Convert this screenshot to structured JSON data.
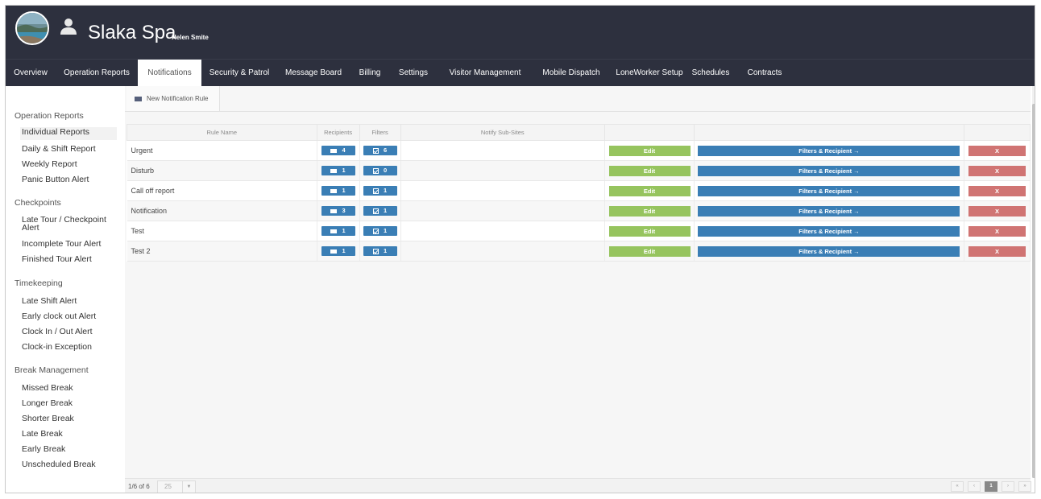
{
  "header": {
    "site_name": "Slaka Spa",
    "user_name": "Helen Smite"
  },
  "nav": {
    "items": [
      {
        "label": "Overview"
      },
      {
        "label": "Operation Reports"
      },
      {
        "label": "Notifications"
      },
      {
        "label": "Security & Patrol"
      },
      {
        "label": "Message Board"
      },
      {
        "label": "Billing"
      },
      {
        "label": "Settings"
      },
      {
        "label": "Visitor Management"
      },
      {
        "label": "Mobile Dispatch"
      },
      {
        "label": "LoneWorker Setup"
      },
      {
        "label": "Schedules"
      },
      {
        "label": "Contracts"
      }
    ],
    "active": "Notifications"
  },
  "sidebar": {
    "groups": [
      {
        "title": "Operation Reports",
        "items": [
          "Individual Reports",
          "Daily & Shift Report",
          "Weekly Report",
          "Panic Button Alert"
        ]
      },
      {
        "title": "Checkpoints",
        "items": [
          "Late Tour / Checkpoint Alert",
          "Incomplete Tour Alert",
          "Finished Tour Alert"
        ]
      },
      {
        "title": "Timekeeping",
        "items": [
          "Late Shift Alert",
          "Early clock out Alert",
          "Clock In / Out Alert",
          "Clock-in Exception"
        ]
      },
      {
        "title": "Break Management",
        "items": [
          "Missed Break",
          "Longer Break",
          "Shorter Break",
          "Late Break",
          "Early Break",
          "Unscheduled Break"
        ]
      }
    ],
    "active_item": "Individual Reports"
  },
  "toolbar": {
    "new_rule_label": "New Notification Rule"
  },
  "table": {
    "columns": [
      "Rule Name",
      "Recipients",
      "Filters",
      "Notify Sub-Sites",
      "",
      "",
      ""
    ],
    "edit_label": "Edit",
    "filters_label": "Filters & Recipient →",
    "delete_label": "X",
    "rows": [
      {
        "name": "Urgent",
        "recipients": "4",
        "filters": "6"
      },
      {
        "name": "Disturb",
        "recipients": "1",
        "filters": "0"
      },
      {
        "name": "Call off report",
        "recipients": "1",
        "filters": "1"
      },
      {
        "name": "Notification",
        "recipients": "3",
        "filters": "1"
      },
      {
        "name": "Test",
        "recipients": "1",
        "filters": "1"
      },
      {
        "name": "Test 2",
        "recipients": "1",
        "filters": "1"
      }
    ]
  },
  "pagination": {
    "info": "1/6 of 6",
    "page_size": "25",
    "first": "«",
    "prev": "‹",
    "current": "1",
    "next": "›",
    "last": "»"
  },
  "colors": {
    "header_bg": "#2d303e",
    "edit_button": "#96c45e",
    "filters_button": "#3a7eb5",
    "delete_button": "#d07473",
    "badge": "#3a7eb5"
  }
}
